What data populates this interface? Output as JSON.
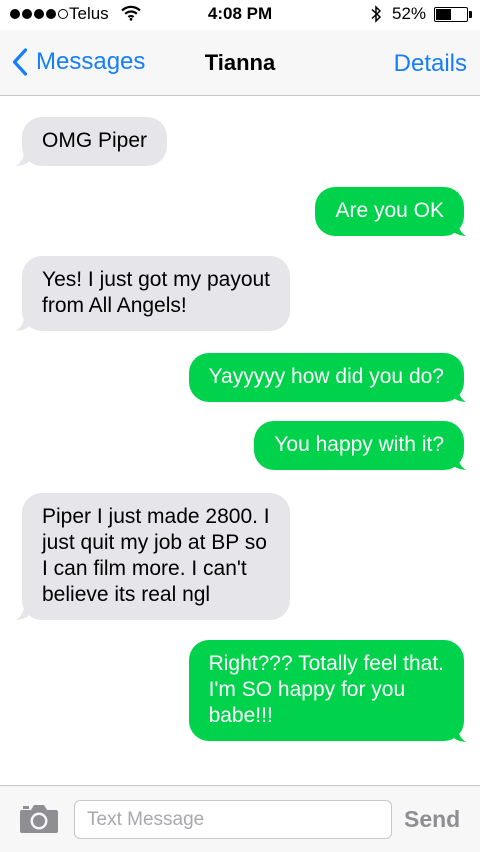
{
  "status_bar": {
    "carrier": "Telus",
    "time": "4:08 PM",
    "battery_percent": "52%",
    "battery_level": 0.52,
    "signal_bars": 4,
    "icons": [
      "signal-dots-icon",
      "wifi-icon",
      "bluetooth-icon",
      "battery-icon"
    ]
  },
  "nav": {
    "back_label": "Messages",
    "title": "Tianna",
    "details_label": "Details"
  },
  "messages": [
    {
      "direction": "in",
      "text": "OMG Piper"
    },
    {
      "direction": "out",
      "text": "Are you OK"
    },
    {
      "direction": "in",
      "text": "Yes! I just got my payout\nfrom All Angels!"
    },
    {
      "direction": "out",
      "text": "Yayyyyy how did you do?"
    },
    {
      "direction": "out",
      "text": "You happy with it?"
    },
    {
      "direction": "in",
      "text": "Piper I just made 2800. I\njust quit my job at BP so\nI can film more. I can't\nbelieve its real ngl"
    },
    {
      "direction": "out",
      "text": "Right??? Totally feel that.\nI'm SO happy for you\nbabe!!!"
    }
  ],
  "input_bar": {
    "placeholder": "Text Message",
    "value": "",
    "send_label": "Send",
    "camera_icon": "camera-icon"
  },
  "colors": {
    "accent": "#157efb",
    "outgoing_bubble": "#00d24c",
    "incoming_bubble": "#e5e5ea",
    "send_disabled": "#8e8e93"
  }
}
